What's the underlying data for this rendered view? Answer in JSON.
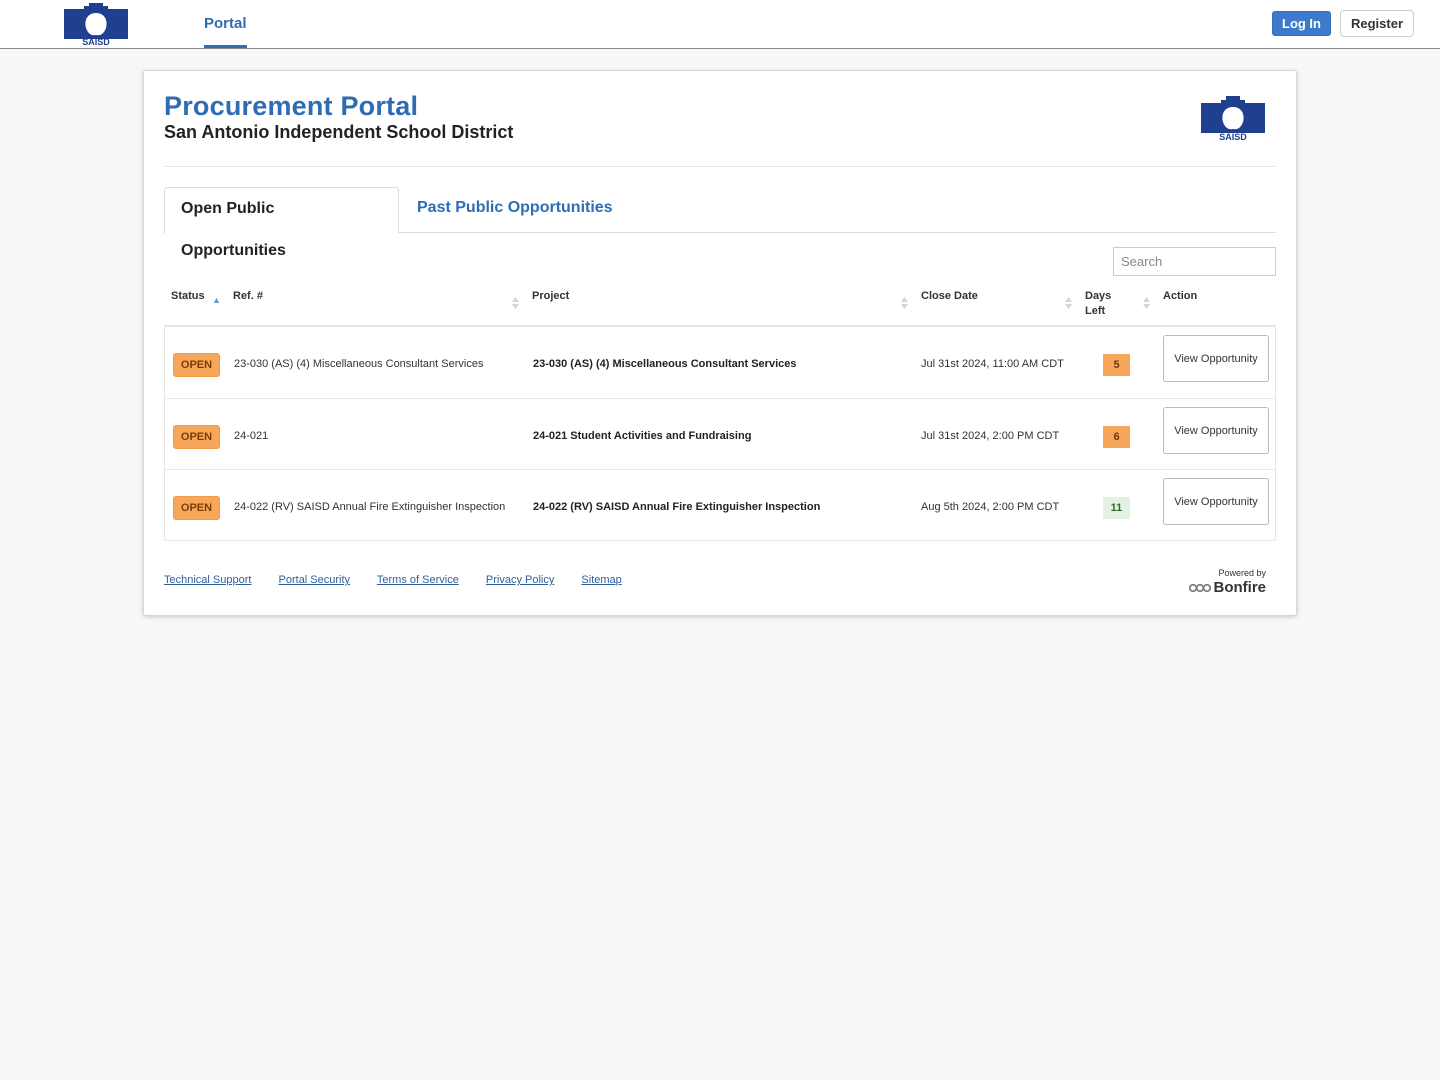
{
  "header": {
    "logo_text": "SAISD",
    "nav": [
      {
        "label": "Portal",
        "active": true
      }
    ],
    "login_label": "Log In",
    "register_label": "Register",
    "accent_color": "#2e6db3"
  },
  "card": {
    "title": "Procurement Portal",
    "subtitle": "San Antonio Independent School District",
    "logo_text": "SAISD",
    "tabs": [
      {
        "label": "Open Public Opportunities",
        "active": true
      },
      {
        "label": "Past Public Opportunities",
        "active": false
      }
    ],
    "search": {
      "placeholder": "Search",
      "value": ""
    },
    "table": {
      "columns": [
        {
          "label": "Status",
          "sort": "asc"
        },
        {
          "label": "Ref. #",
          "sort": "none"
        },
        {
          "label": "Project",
          "sort": "none"
        },
        {
          "label": "Close Date",
          "sort": "none"
        },
        {
          "label": "Days Left",
          "sort": "none"
        },
        {
          "label": "Action"
        }
      ],
      "rows": [
        {
          "status": "OPEN",
          "ref": "23-030 (AS) (4) Miscellaneous Consultant Services",
          "project": "23-030 (AS) (4) Miscellaneous Consultant Services",
          "close_date": "Jul 31st 2024, 11:00 AM CDT",
          "days_left": "5",
          "days_level": "warn",
          "action": "View Opportunity"
        },
        {
          "status": "OPEN",
          "ref": "24-021",
          "project": "24-021 Student Activities and Fundraising",
          "close_date": "Jul 31st 2024, 2:00 PM CDT",
          "days_left": "6",
          "days_level": "warn",
          "action": "View Opportunity"
        },
        {
          "status": "OPEN",
          "ref": "24-022 (RV) SAISD Annual Fire Extinguisher Inspection",
          "project": "24-022 (RV) SAISD Annual Fire Extinguisher Inspection",
          "close_date": "Aug 5th 2024, 2:00 PM CDT",
          "days_left": "11",
          "days_level": "ok",
          "action": "View Opportunity"
        }
      ]
    },
    "footer": {
      "links": [
        "Technical Support",
        "Portal Security",
        "Terms of Service",
        "Privacy Policy",
        "Sitemap"
      ],
      "powered_by": "Powered by",
      "brand": "Bonfire"
    }
  }
}
